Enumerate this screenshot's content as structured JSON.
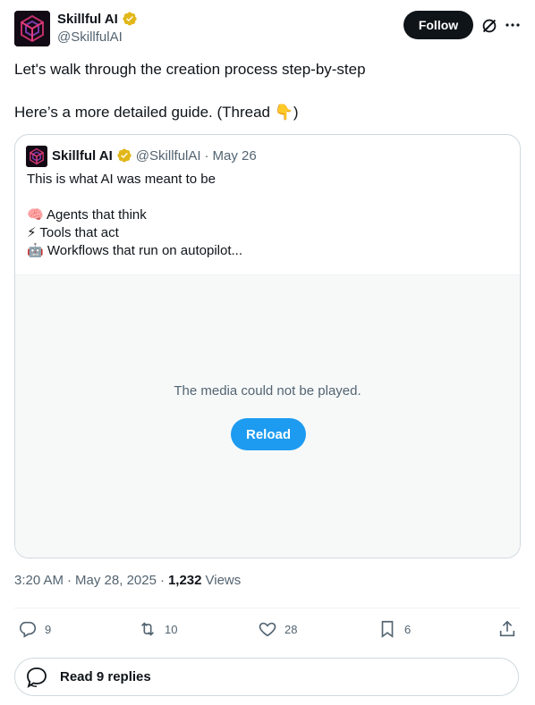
{
  "author": {
    "name": "Skillful AI",
    "handle": "@SkillfulAI",
    "follow_label": "Follow"
  },
  "tweet": {
    "line1": "Let's walk through the creation process step-by-step",
    "line2": "Here’s a more detailed guide. (Thread 👇)"
  },
  "quote": {
    "name": "Skillful AI",
    "handle": "@SkillfulAI",
    "separator": "·",
    "date": "May 26",
    "lines": [
      "This is what AI was meant to be",
      "",
      "🧠 Agents that think",
      "⚡ Tools that act",
      "🤖 Workflows that run on autopilot..."
    ],
    "media_message": "The media could not be played.",
    "reload_label": "Reload"
  },
  "meta": {
    "time": "3:20 AM",
    "dot1": "·",
    "date": "May 28, 2025",
    "dot2": "·",
    "views_count": "1,232",
    "views_label": "Views"
  },
  "actions": {
    "replies": "9",
    "reposts": "10",
    "likes": "28",
    "bookmarks": "6"
  },
  "read_replies_label": "Read 9 replies",
  "colors": {
    "accent": "#1d9bf0",
    "verified": "#e2b719",
    "text": "#0f1419",
    "secondary": "#536471"
  }
}
